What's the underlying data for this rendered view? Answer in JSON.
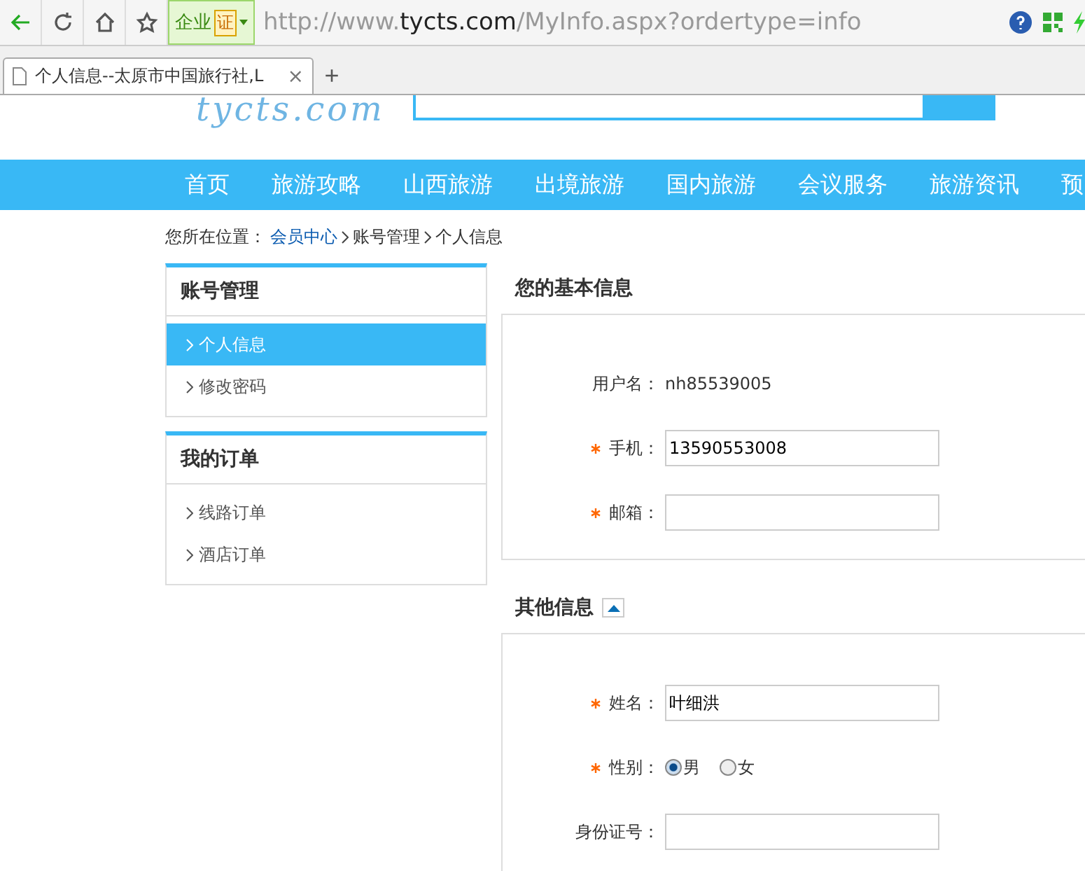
{
  "browser": {
    "badge": "企业",
    "badge_mark": "证",
    "url_host_prefix": "http://www.",
    "url_host": "tycts.com",
    "url_path": "/MyInfo.aspx?ordertype=info",
    "tab_title": "个人信息--太原市中国旅行社,L",
    "tab_close": "×",
    "new_tab": "+"
  },
  "header": {
    "logo": "tycts.com"
  },
  "nav": [
    "首页",
    "旅游攻略",
    "山西旅游",
    "出境旅游",
    "国内旅游",
    "会议服务",
    "旅游资讯",
    "预"
  ],
  "breadcrumb": {
    "label": "您所在位置：",
    "link": "会员中心",
    "items": [
      "账号管理",
      "个人信息"
    ]
  },
  "sidebar": [
    {
      "title": "账号管理",
      "items": [
        {
          "label": "个人信息",
          "selected": true
        },
        {
          "label": "修改密码",
          "selected": false
        }
      ]
    },
    {
      "title": "我的订单",
      "items": [
        {
          "label": "线路订单",
          "selected": false
        },
        {
          "label": "酒店订单",
          "selected": false
        }
      ]
    }
  ],
  "sections": [
    {
      "title": "您的基本信息",
      "rows": [
        {
          "kind": "text",
          "label": "用户名：",
          "required": false,
          "value": "nh85539005"
        },
        {
          "kind": "input",
          "label": "手机：",
          "required": true,
          "value": "13590553008"
        },
        {
          "kind": "input",
          "label": "邮箱：",
          "required": true,
          "value": ""
        }
      ]
    },
    {
      "title": "其他信息",
      "expanded": true,
      "rows": [
        {
          "kind": "input",
          "label": "姓名：",
          "required": true,
          "value": "叶细洪"
        },
        {
          "kind": "radio",
          "label": "性别：",
          "required": true,
          "options": [
            {
              "label": "男",
              "selected": true
            },
            {
              "label": "女",
              "selected": false
            }
          ]
        },
        {
          "kind": "input",
          "label": "身份证号：",
          "required": false,
          "value": ""
        }
      ]
    }
  ]
}
